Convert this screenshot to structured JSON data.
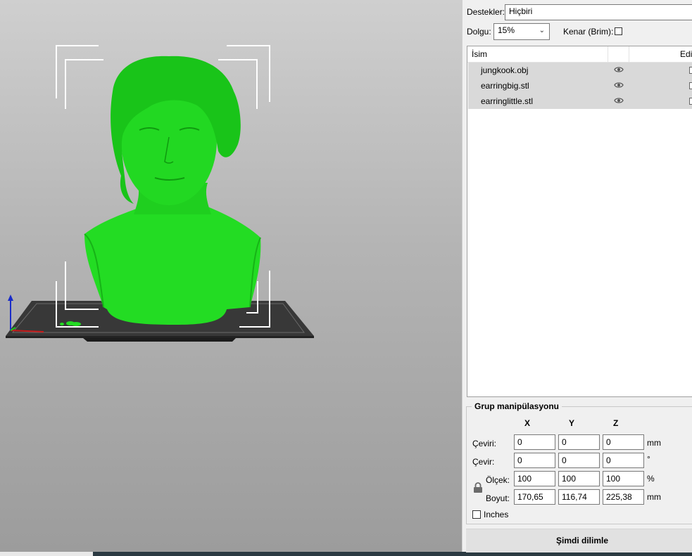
{
  "settings": {
    "supports_label": "Destekler:",
    "supports_value": "Hiçbiri",
    "infill_label": "Dolgu:",
    "infill_value": "15%",
    "brim_label": "Kenar (Brim):",
    "brim_checked": false
  },
  "object_list": {
    "col_name": "İsim",
    "col_edit": "Edi",
    "items": [
      {
        "name": "jungkook.obj",
        "icon": "eye-icon"
      },
      {
        "name": "earringbig.stl",
        "icon": "eye-icon"
      },
      {
        "name": "earringlittle.stl",
        "icon": "eye-icon"
      }
    ]
  },
  "manipulation": {
    "title": "Grup manipülasyonu",
    "axes": [
      "X",
      "Y",
      "Z"
    ],
    "position": {
      "label": "Çeviri:",
      "x": "0",
      "y": "0",
      "z": "0",
      "unit": "mm"
    },
    "rotation": {
      "label": "Çevir:",
      "x": "0",
      "y": "0",
      "z": "0",
      "unit": "°"
    },
    "scale": {
      "label": "Ölçek:",
      "x": "100",
      "y": "100",
      "z": "100",
      "unit": "%"
    },
    "size": {
      "label": "Boyut:",
      "x": "170,65",
      "y": "116,74",
      "z": "225,38",
      "unit": "mm"
    },
    "inches_label": "Inches",
    "lock_icon": "lock-icon"
  },
  "slice_button": "Şimdi dilimle",
  "colors": {
    "model": "#1ee01e",
    "bed": "#3a3a3a"
  }
}
